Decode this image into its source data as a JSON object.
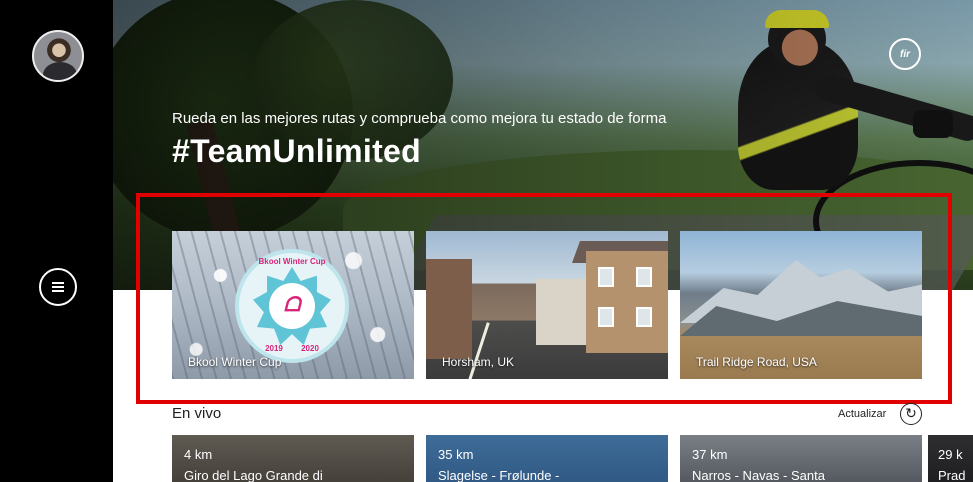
{
  "hero": {
    "subtitle": "Rueda en las mejores rutas y comprueba como mejora tu estado de forma",
    "title": "#TeamUnlimited"
  },
  "icons": {
    "avatar": "user-avatar",
    "menu": "hamburger-menu-icon",
    "brand": "bkool-logo-icon",
    "refresh": "refresh-icon"
  },
  "brand": {
    "logo_text": "fir"
  },
  "routes": [
    {
      "label": "Bkool Winter Cup"
    },
    {
      "label": "Horsham, UK"
    },
    {
      "label": "Trail Ridge Road, USA"
    }
  ],
  "badge": {
    "top": "Bkool Winter Cup",
    "years": "2019 2020",
    "mark": "ᗝ"
  },
  "live": {
    "title": "En vivo",
    "refresh_label": "Actualizar",
    "refresh_glyph": "↻",
    "items": [
      {
        "distance": "4 km",
        "name": "Giro del Lago Grande di"
      },
      {
        "distance": "35 km",
        "name": "Slagelse - Frølunde -"
      },
      {
        "distance": "37 km",
        "name": "Narros - Navas - Santa"
      },
      {
        "distance": "29 k",
        "name": "Prad"
      }
    ]
  },
  "colors": {
    "highlight": "#e00000",
    "sidebar": "#000000",
    "badge_accent": "#d8267b"
  }
}
